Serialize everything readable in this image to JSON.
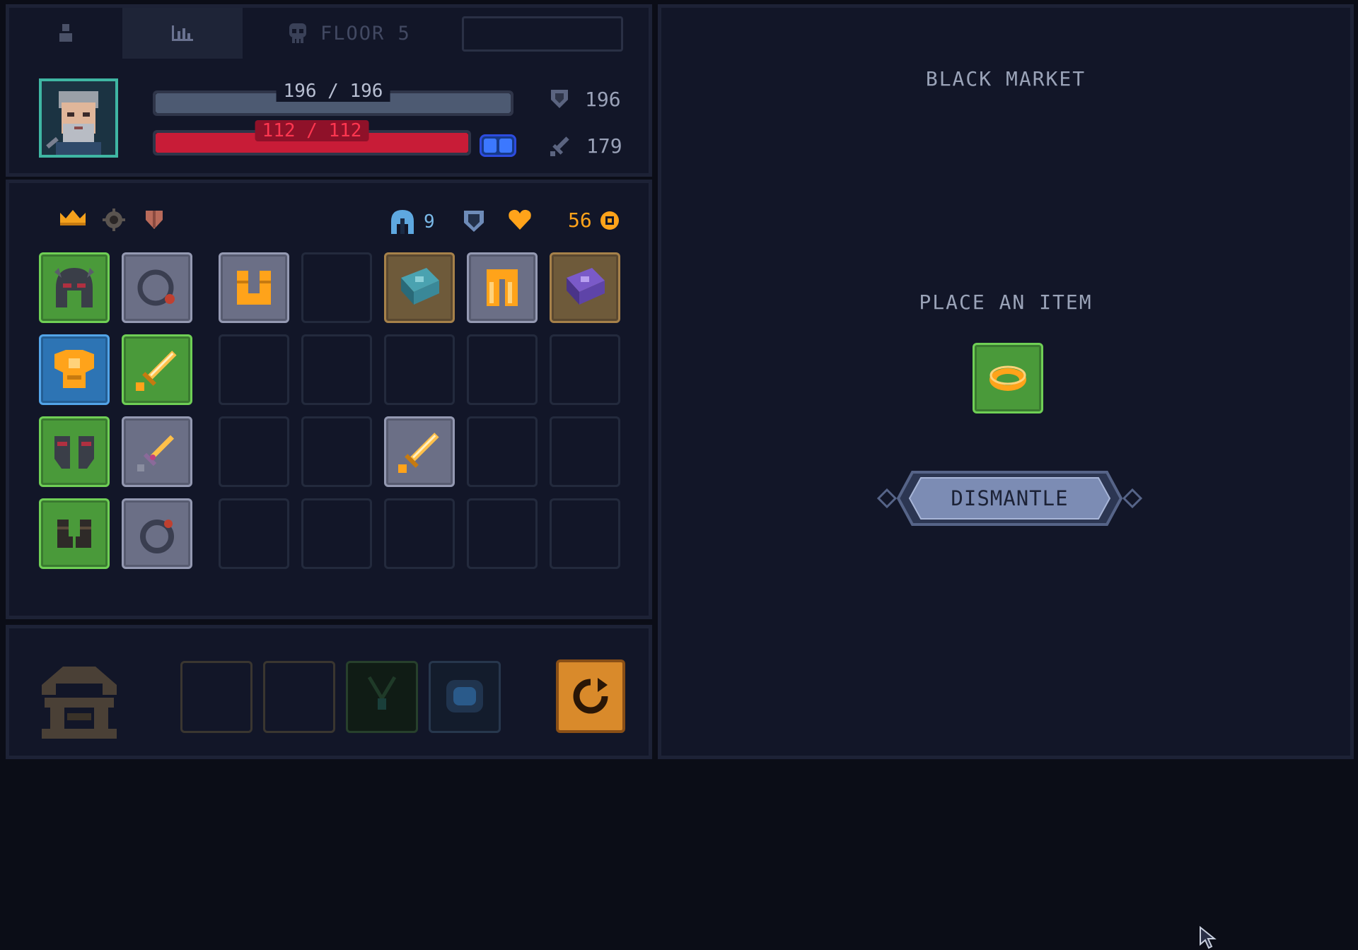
{
  "header": {
    "floor_label": "FLOOR 5",
    "search_value": ""
  },
  "player": {
    "armor_text": "196 / 196",
    "armor_fraction": 1.0,
    "hp_text": "112 / 112",
    "hp_fraction": 1.0,
    "defense": "196",
    "attack": "179"
  },
  "inventory": {
    "helm_count": "9",
    "gold": "56",
    "slots": [
      [
        "helmet-green",
        "ring-grey",
        "boots-grey",
        "empty",
        "spellbook-gold",
        "pants-grey",
        "spellbook-gold-purple"
      ],
      [
        "chestplate-blue",
        "sword-green",
        "empty",
        "empty",
        "empty",
        "empty",
        "empty"
      ],
      [
        "pauldrons-green",
        "dagger-grey",
        "empty",
        "empty",
        "sword-grey",
        "empty",
        "empty"
      ],
      [
        "boots-green",
        "ring-grey-red",
        "empty",
        "empty",
        "empty",
        "empty",
        "empty"
      ]
    ]
  },
  "bottom": {
    "slots": [
      "empty",
      "empty",
      "green-locked",
      "blue-locked"
    ]
  },
  "market": {
    "title": "BLACK MARKET",
    "place_label": "PLACE AN ITEM",
    "offered_item": "gold-ring",
    "dismantle_label": "DISMANTLE"
  },
  "colors": {
    "background": "#0b0d17",
    "panel": "#121628",
    "hp_red": "#c81c37",
    "gold": "#ffa31a",
    "rarity_green": "#4a9a3a",
    "rarity_blue": "#2d74b4",
    "rarity_grey": "#6b6f86"
  }
}
